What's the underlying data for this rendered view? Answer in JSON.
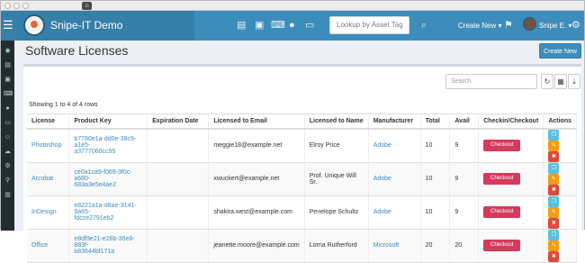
{
  "app": {
    "title": "Snipe-IT Demo"
  },
  "topnav": {
    "search_placeholder": "Lookup by Asset Tag",
    "create_new": "Create New ▾",
    "user_name": "Snipe E. ▾"
  },
  "page": {
    "title": "Software Licenses",
    "create_button": "Create New"
  },
  "toolbar": {
    "search_placeholder": "Search"
  },
  "table": {
    "showing": "Showing 1 to 4 of 4 rows",
    "columns": [
      "License",
      "Product Key",
      "Expiration Date",
      "Licensed to Email",
      "Licensed to Name",
      "Manufacturer",
      "Total",
      "Avail",
      "Checkin/Checkout",
      "Actions"
    ],
    "rows": [
      {
        "license": "Photoshop",
        "key_line1": "b7780e1a-dd0e-38c9-a1e5-",
        "key_line2": "a3777060cc55",
        "expiration": "",
        "email": "meggie18@example.net",
        "name": "Elroy Price",
        "manufacturer": "Adobe",
        "total": "10",
        "avail": "9",
        "checkout": "Checkout"
      },
      {
        "license": "Acrobat",
        "key_line1": "ce0a1ca9-f069-3f0c-a680-",
        "key_line2": "683a3e5e4ae2",
        "expiration": "",
        "email": "xwuckert@example.net",
        "name": "Prof. Unique Will Sr.",
        "manufacturer": "Adobe",
        "total": "10",
        "avail": "9",
        "checkout": "Checkout"
      },
      {
        "license": "InDesign",
        "key_line1": "e8221a1a-d8ae-3141-9a65-",
        "key_line2": "fdcce2791eb2",
        "expiration": "",
        "email": "shakira.west@example.com",
        "name": "Penelope Schultz",
        "manufacturer": "Adobe",
        "total": "10",
        "avail": "9",
        "checkout": "Checkout"
      },
      {
        "license": "Office",
        "key_line1": "e8df9e21-e28b-36e8-883f-",
        "key_line2": "b83644bf171a",
        "expiration": "",
        "email": "jeanette.moore@example.com",
        "name": "Lorna Rutherford",
        "manufacturer": "Microsoft",
        "total": "20",
        "avail": "20",
        "checkout": "Checkout"
      }
    ]
  }
}
